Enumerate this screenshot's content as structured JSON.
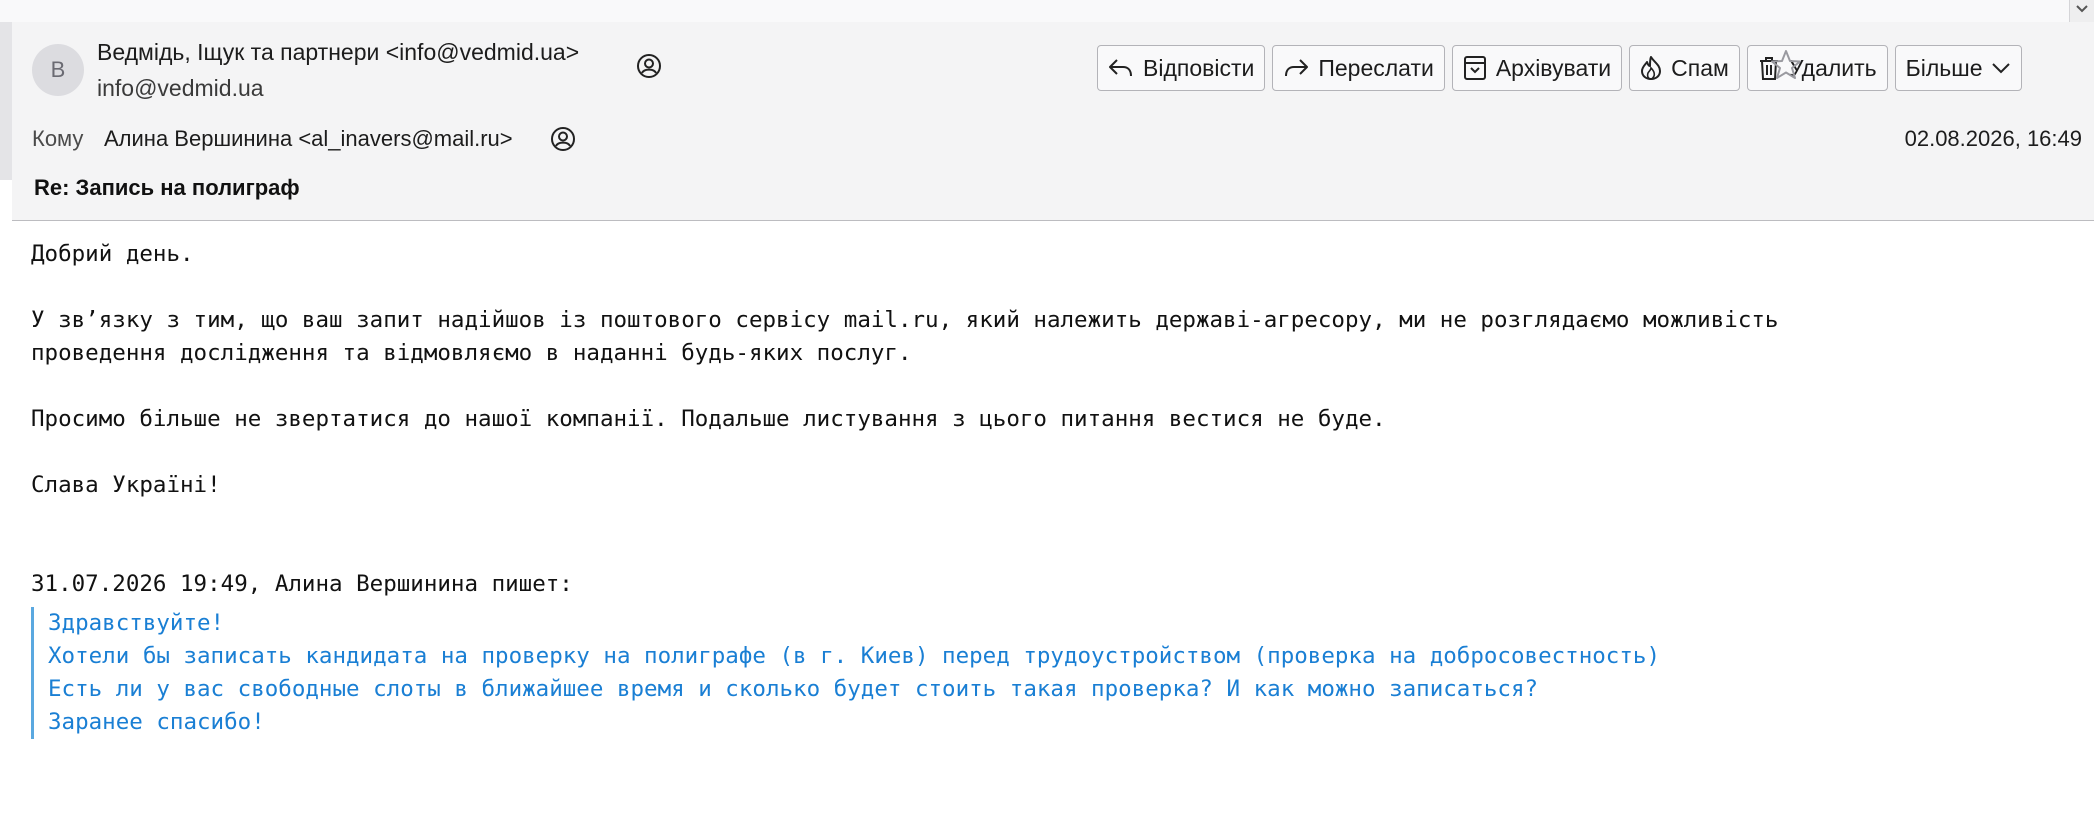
{
  "header": {
    "avatar_letter": "В",
    "from_name": "Ведмідь, Іщук та партнери <info@vedmid.ua>",
    "from_email": "info@vedmid.ua",
    "to_label": "Кому",
    "to_value": "Алина Вершинина <al_inavers@mail.ru>",
    "date": "02.08.2026, 16:49",
    "subject": "Re: Запись на полиграф"
  },
  "toolbar": {
    "reply": "Відповісти",
    "forward": "Переслати",
    "archive": "Архівувати",
    "spam": "Спам",
    "delete": "Удалить",
    "more": "Більше"
  },
  "body": {
    "greeting": "Добрий день.",
    "para1_line1": "У зв’язку з тим, що ваш запит надійшов із поштового сервісу mail.ru, який належить державі-агресору, ми не розглядаємо можливість",
    "para1_line2": "проведення дослідження та відмовляємо в наданні будь-яких послуг.",
    "para2": "Просимо більше не звертатися до нашої компанії. Подальше листування з цього питання вестися не буде.",
    "closing": "Слава Україні!",
    "quote_header": "31.07.2026 19:49, Алина Вершинина пишет:",
    "quote_lines": [
      "Здравствуйте!",
      "Хотели бы записать кандидата на проверку на полиграфе (в г. Киев) перед трудоустройством (проверка на добросовестность)",
      "Есть ли у вас свободные слоты в ближайшее время и сколько будет стоить такая проверка? И как можно записаться?",
      "Заранее спасибо!"
    ]
  },
  "icons": {
    "reply": "reply-icon",
    "forward": "forward-icon",
    "archive": "archive-icon",
    "spam": "spam-icon",
    "delete": "trash-icon",
    "more": "chevron-down-icon",
    "star": "star-icon",
    "contact": "contact-icon"
  },
  "colors": {
    "quote_text": "#1a7fd4",
    "quote_bar": "#5aa8e0",
    "header_bg": "#f4f4f5"
  }
}
